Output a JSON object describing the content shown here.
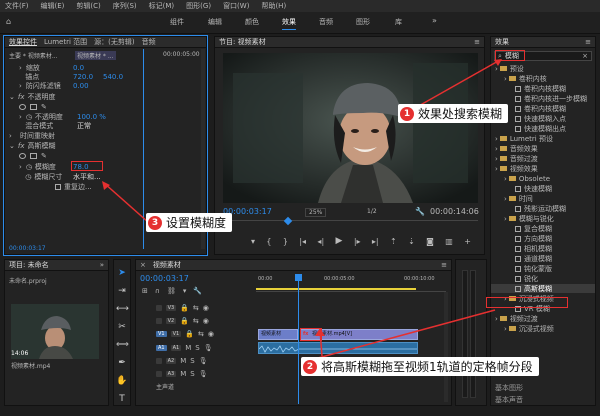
{
  "menu": [
    "文件(F)",
    "编辑(E)",
    "剪辑(C)",
    "序列(S)",
    "标记(M)",
    "图形(G)",
    "窗口(W)",
    "帮助(H)"
  ],
  "workspace_tabs": [
    "组件",
    "编辑",
    "颜色",
    "效果",
    "音频",
    "图形",
    "库"
  ],
  "effect_controls": {
    "tabs": [
      "效果控件",
      "Lumetri 范围",
      "源：(无剪辑)",
      "音频"
    ],
    "source": "主要 * 视频素材...",
    "seq": "视频素材 * ...",
    "tc": "00:00:05:00",
    "rows": {
      "scale": "缩放",
      "scale_v": "0.0",
      "anchor": "锚点",
      "anchor_x": "720.0",
      "anchor_y": "540.0",
      "flicker": "防闪烁滤镜",
      "flicker_v": "0.00",
      "opacity_h": "不透明度",
      "opacity": "不透明度",
      "opacity_v": "100.0 %",
      "blend": "混合模式",
      "blend_v": "正常",
      "remap": "时间重映射",
      "blur_h": "高斯模糊",
      "blurriness": "模糊度",
      "blurriness_v": "78.0",
      "dims": "模糊尺寸",
      "dims_v": "水平和...",
      "repeat": "重复边..."
    },
    "footer_tc": "00:00:03:17"
  },
  "program": {
    "title": "节目: 视频素材",
    "tc": "00:00:03:17",
    "zoom": "25%",
    "res": "1/2",
    "duration": "00:00:14:06"
  },
  "effects": {
    "title": "效果",
    "search": "模糊",
    "items": [
      {
        "t": "预设",
        "kind": "folder",
        "indent": 0
      },
      {
        "t": "卷积内核",
        "kind": "folder",
        "indent": 1
      },
      {
        "t": "卷积内核模糊",
        "kind": "fx",
        "indent": 2
      },
      {
        "t": "卷积内核进一步模糊",
        "kind": "fx",
        "indent": 2
      },
      {
        "t": "卷积内核模糊",
        "kind": "fx",
        "indent": 2
      },
      {
        "t": "快速模糊入点",
        "kind": "fx",
        "indent": 2
      },
      {
        "t": "快速模糊出点",
        "kind": "fx",
        "indent": 2
      },
      {
        "t": "Lumetri 预设",
        "kind": "folder",
        "indent": 0
      },
      {
        "t": "音频效果",
        "kind": "folder",
        "indent": 0
      },
      {
        "t": "音频过渡",
        "kind": "folder",
        "indent": 0
      },
      {
        "t": "视频效果",
        "kind": "folder",
        "indent": 0
      },
      {
        "t": "Obsolete",
        "kind": "folder",
        "indent": 1
      },
      {
        "t": "快速模糊",
        "kind": "fx",
        "indent": 2
      },
      {
        "t": "时间",
        "kind": "folder",
        "indent": 1
      },
      {
        "t": "残影运动模糊",
        "kind": "fx",
        "indent": 2
      },
      {
        "t": "模糊与锐化",
        "kind": "folder",
        "indent": 1
      },
      {
        "t": "复合模糊",
        "kind": "fx",
        "indent": 2
      },
      {
        "t": "方向模糊",
        "kind": "fx",
        "indent": 2
      },
      {
        "t": "相机模糊",
        "kind": "fx",
        "indent": 2
      },
      {
        "t": "通道模糊",
        "kind": "fx",
        "indent": 2
      },
      {
        "t": "钝化蒙版",
        "kind": "fx",
        "indent": 2
      },
      {
        "t": "锐化",
        "kind": "fx",
        "indent": 2
      },
      {
        "t": "高斯模糊",
        "kind": "fx",
        "indent": 2,
        "selected": true
      },
      {
        "t": "沉浸式视频",
        "kind": "folder",
        "indent": 1
      },
      {
        "t": "VR 模糊",
        "kind": "fx",
        "indent": 2
      },
      {
        "t": "视频过渡",
        "kind": "folder",
        "indent": 0
      },
      {
        "t": "沉浸式视频",
        "kind": "folder",
        "indent": 1
      }
    ],
    "footer": [
      "基本图形",
      "基本声音"
    ]
  },
  "project": {
    "title": "项目: 未命名",
    "file": "未命名.prproj",
    "clip": "视频素材.mp4",
    "clip_dur": "14:06"
  },
  "timeline": {
    "title": "视频素材",
    "tc": "00:00:03:17",
    "ruler": [
      "00:00",
      "00:00:05:00",
      "00:00:10:00"
    ],
    "tracks_v": [
      "V3",
      "V2",
      "V1"
    ],
    "tracks_a": [
      "A1",
      "A2",
      "A3"
    ],
    "clip1": "视频素材",
    "clip2": "视频素材.mp4[V]",
    "master": "主声道"
  },
  "callouts": {
    "c1": "效果处搜索模糊",
    "c2": "将高斯模糊拖至视频1轨道的定格帧分段",
    "c3": "设置模糊度"
  },
  "colors": {
    "accent": "#2d8ceb",
    "callout": "#e53030"
  }
}
